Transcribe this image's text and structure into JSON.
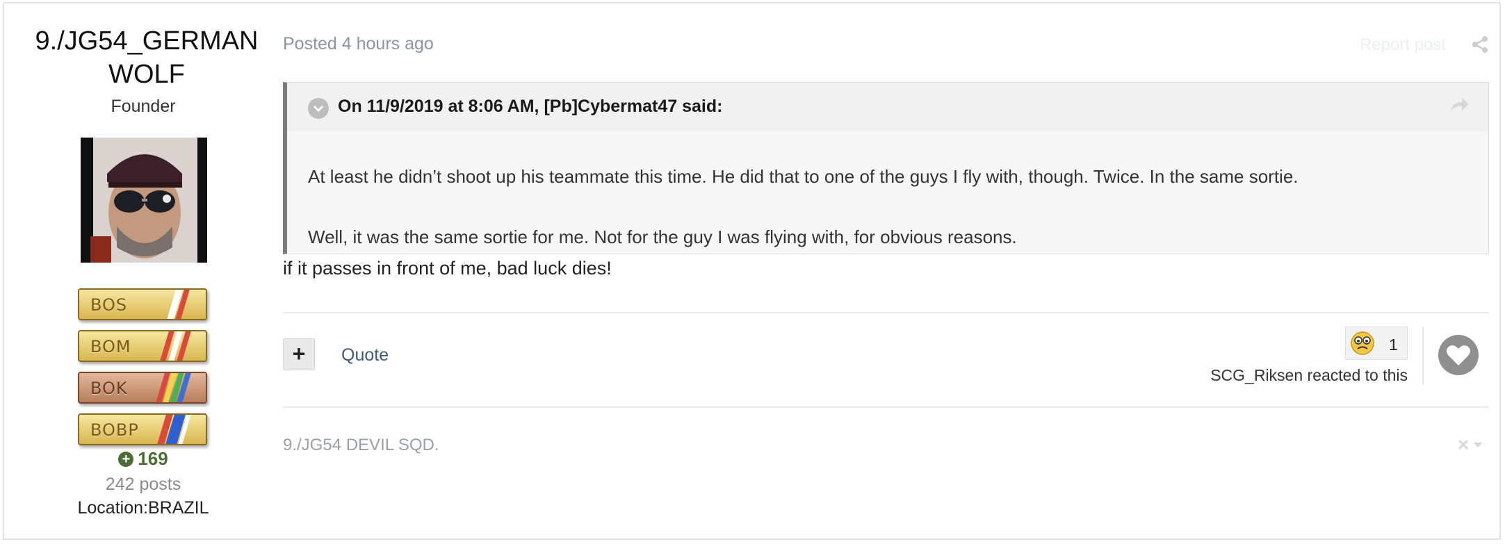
{
  "author": {
    "name": "9./JG54_GERMAN WOLF",
    "role": "Founder",
    "badges": [
      {
        "label": "BOS"
      },
      {
        "label": "BOM"
      },
      {
        "label": "BOK"
      },
      {
        "label": "BOBP"
      }
    ],
    "reputation": "169",
    "posts": "242 posts",
    "location": "Location:BRAZIL"
  },
  "post": {
    "meta": "Posted 4 hours ago",
    "report_label": "Report post",
    "quote": {
      "citation": "On 11/9/2019 at 8:06 AM, [Pb]Cybermat47 said:",
      "paragraphs": [
        "At least he didn’t shoot up his teammate this time. He did that to one of the guys I fly with, though. Twice. In the same sortie.",
        "Well, it was the same sortie for me. Not for the guy I was flying with, for obvious reasons."
      ]
    },
    "body": "if it passes in front of me, bad luck dies!"
  },
  "actions": {
    "add_label": "+",
    "quote_label": "Quote"
  },
  "reactions": {
    "count": "1",
    "summary": "SCG_Riksen reacted to this"
  },
  "signature": "9./JG54 DEVIL SQD.",
  "colors": {
    "reputation_green": "#4e6b35",
    "link_blue": "#3f5a73",
    "quote_border": "#7a7a7a"
  }
}
